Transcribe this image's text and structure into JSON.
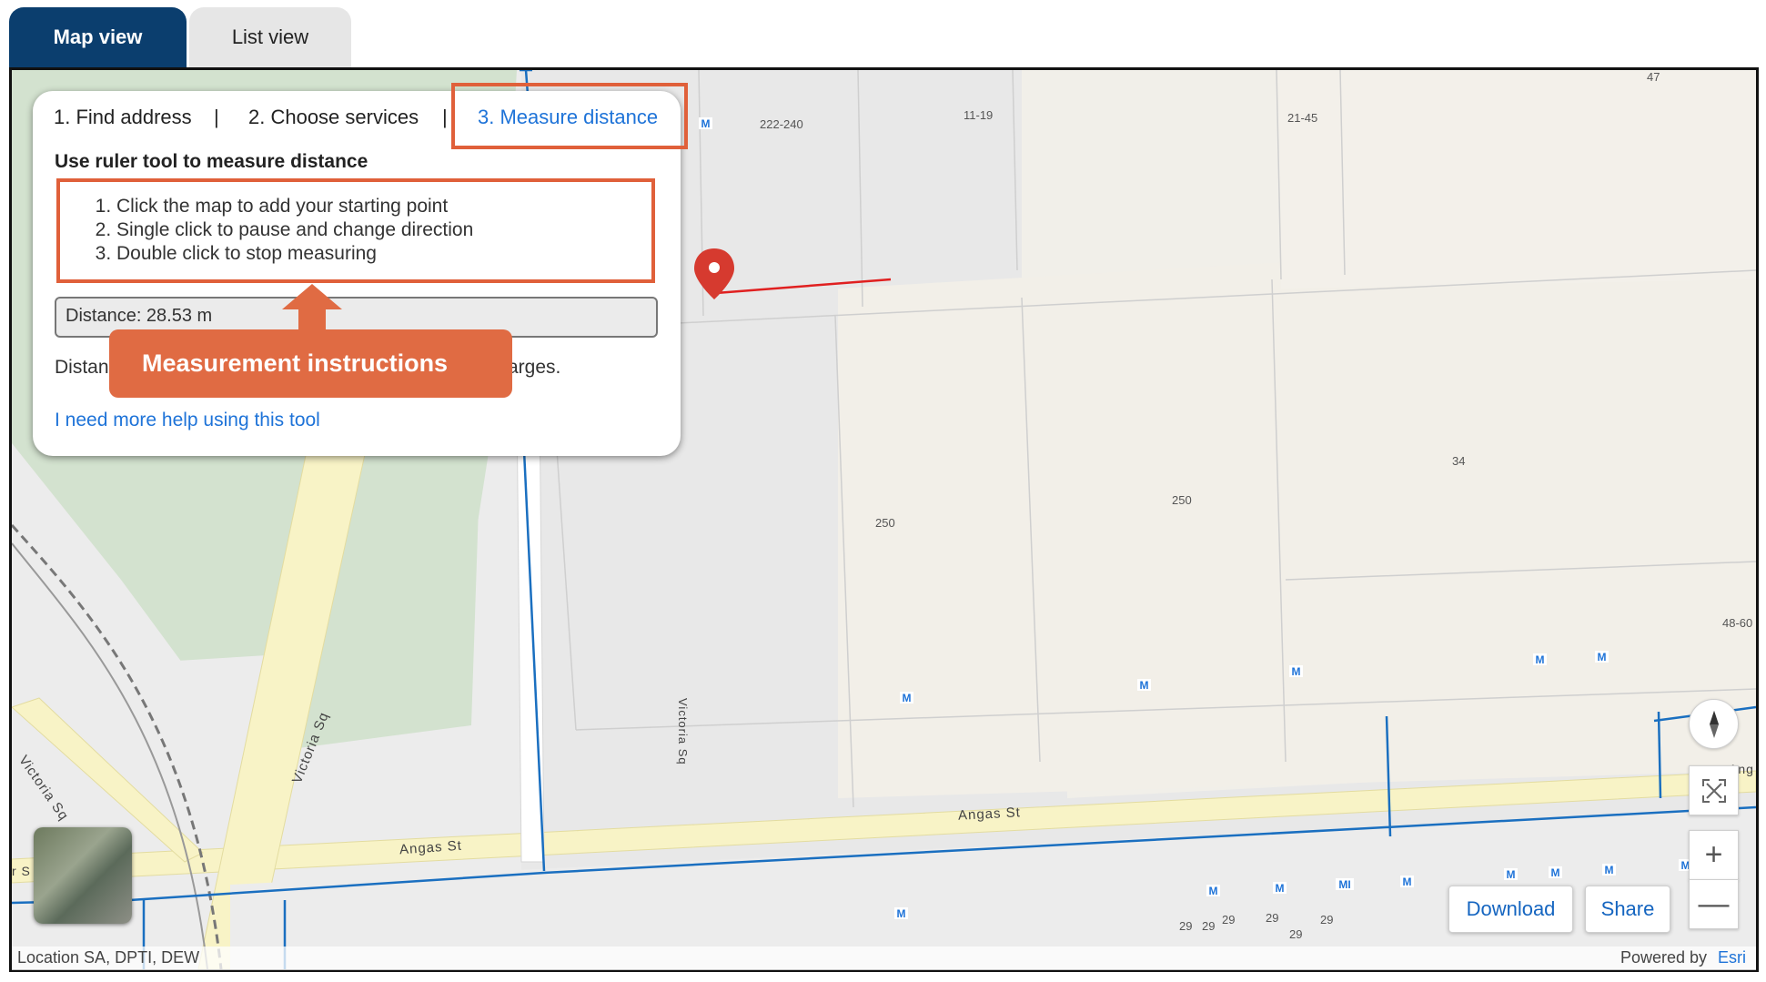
{
  "tabs": {
    "map_view": "Map view",
    "list_view": "List view"
  },
  "panel": {
    "step1": "1. Find address",
    "separator": "|",
    "step2": "2. Choose services",
    "step3": "3. Measure distance",
    "title": "Use ruler tool to measure distance",
    "instructions": [
      "Click the map to add your starting point",
      "Single click to pause and change direction",
      "Double click to stop measuring"
    ],
    "distance": "Distance: 28.53 m",
    "distance_note_start": "Distan",
    "distance_note_end": "arges.",
    "help_link": "I need more help using this tool"
  },
  "callout": {
    "label": "Measurement instructions"
  },
  "map": {
    "lot_labels": [
      "222-240",
      "11-19",
      "21-45",
      "47",
      "250",
      "250",
      "34",
      "48-60",
      "29",
      "29",
      "29",
      "29",
      "29",
      "29"
    ],
    "street_labels": [
      "Angas St",
      "Angas St",
      "Victoria Sq",
      "Victoria Sq",
      "Victoria Sq",
      "Ang",
      "r S"
    ],
    "meter_marker": "M",
    "meter_marker_alt": "MI",
    "measure_color": "#e02020",
    "pipe_color": "#1a6fc0",
    "accent_color": "#e0603a",
    "tab_active_color": "#0b3e6e"
  },
  "controls": {
    "compass_icon": "compass-icon",
    "fullscreen_icon": "expand-icon",
    "zoom_in": "+",
    "zoom_out": "—",
    "download": "Download",
    "share": "Share"
  },
  "attribution": {
    "left": "Location SA, DPTI, DEW",
    "powered_by": "Powered by",
    "esri": "Esri"
  }
}
